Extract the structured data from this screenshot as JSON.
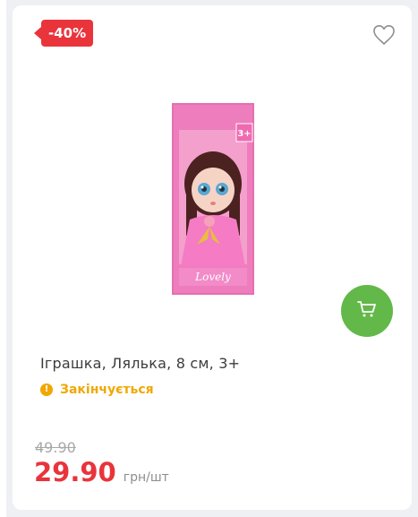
{
  "badge": {
    "discount": "-40%"
  },
  "product": {
    "title": "Іграшка, Лялька, 8 см, 3+",
    "stock_status": "Закінчується",
    "old_price": "49.90",
    "price": "29.90",
    "unit": "грн/шт",
    "image_text": {
      "age": "3+",
      "brand": "Lovely"
    }
  },
  "icons": {
    "wishlist": "heart-outline-icon",
    "cart": "cart-icon",
    "stock": "exclamation-icon"
  },
  "colors": {
    "discount_badge": "#e9343b",
    "cart_button": "#63b84a",
    "stock_status": "#f0a800",
    "price": "#e9343b"
  }
}
